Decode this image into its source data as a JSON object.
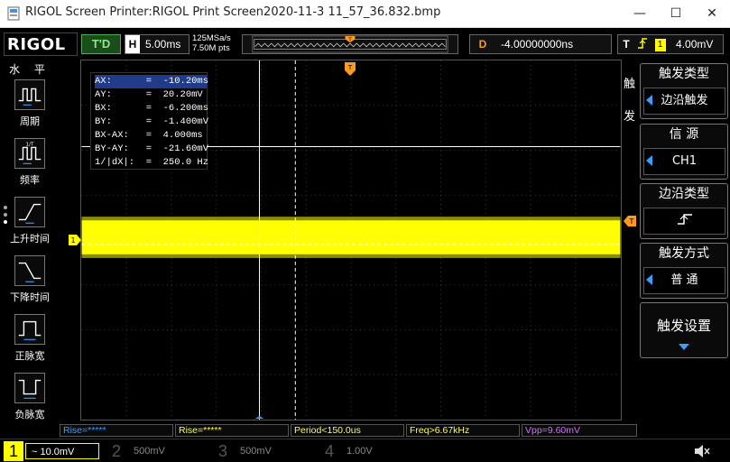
{
  "window": {
    "title": "RIGOL Screen Printer:RIGOL Print Screen2020-11-3 11_57_36.832.bmp",
    "minimize_glyph": "—",
    "maximize_glyph": "☐",
    "close_glyph": "✕"
  },
  "topbar": {
    "logo": "RIGOL",
    "run_state": "T'D",
    "timebase_label": "H",
    "timebase": "5.00ms",
    "sample_rate": "125MSa/s",
    "memory_depth": "7.50M pts",
    "delay_label": "D",
    "delay": "-4.00000000ns",
    "trigger_label": "T",
    "trigger_source_num": "1",
    "trigger_level": "4.00mV"
  },
  "left_menu": {
    "title": "水 平",
    "items": [
      {
        "label": "周期",
        "icon": "period-icon"
      },
      {
        "label": "频率",
        "icon": "frequency-icon"
      },
      {
        "label": "上升时间",
        "icon": "rise-time-icon"
      },
      {
        "label": "下降时间",
        "icon": "fall-time-icon"
      },
      {
        "label": "正脉宽",
        "icon": "positive-width-icon"
      },
      {
        "label": "负脉宽",
        "icon": "negative-width-icon"
      }
    ]
  },
  "cursor": {
    "rows": [
      "AX:      =  -10.20ms",
      "AY:      =  20.20mV",
      "BX:      =  -6.200ms",
      "BY:      =  -1.400mV",
      "BX-AX:   =  4.000ms",
      "BY-AY:   =  -21.60mV",
      "1/|dX|:  =  250.0 Hz"
    ]
  },
  "markers": {
    "trigger_pos": "T",
    "ch1": "1",
    "trigger_level": "T"
  },
  "right_panel": {
    "title": "触发",
    "blocks": [
      {
        "head": "触发类型",
        "value": "边沿触发"
      },
      {
        "head": "信 源",
        "value": "CH1"
      },
      {
        "head": "边沿类型",
        "value": "rising-edge-icon"
      },
      {
        "head": "触发方式",
        "value": "普 通"
      },
      {
        "head": "触发设置",
        "value": ""
      }
    ]
  },
  "measurements": [
    {
      "text": "Rise=*****",
      "color": "#d070ff"
    },
    {
      "text": "Rise=*****",
      "color": "#3aa0ff"
    },
    {
      "text": "Period<150.0us",
      "color": "#ffff40"
    },
    {
      "text": "Freq>6.67kHz",
      "color": "#ffff40"
    },
    {
      "text": "Vpp=9.60mV",
      "color": "#ffff40"
    }
  ],
  "channels": [
    {
      "num": "1",
      "value": "~ 10.0mV",
      "color": "#ffff00"
    },
    {
      "num": "2",
      "value": "500mV",
      "color": "#555555"
    },
    {
      "num": "3",
      "value": "500mV",
      "color": "#555555"
    },
    {
      "num": "4",
      "value": "1.00V",
      "color": "#555555"
    }
  ],
  "colors": {
    "trace": "#ffff00",
    "accent": "#ff9a1f",
    "highlight": "#3aa0ff"
  }
}
